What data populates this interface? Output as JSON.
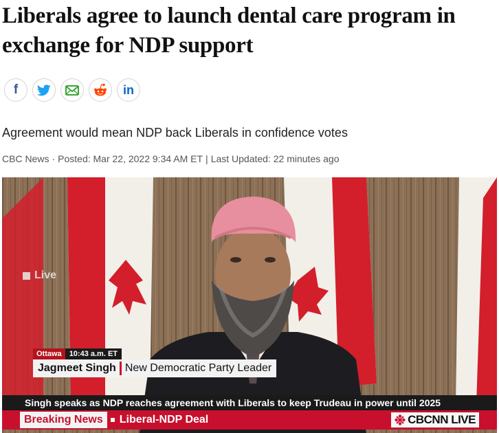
{
  "article": {
    "headline": "Liberals agree to launch dental care program in exchange for NDP support",
    "subtitle": "Agreement would mean NDP back Liberals in confidence votes",
    "byline": {
      "source": "CBC News",
      "posted": "Posted: Mar 22, 2022 9:34 AM ET",
      "updated": "Last Updated: 22 minutes ago"
    }
  },
  "share": [
    {
      "name": "facebook",
      "icon": "facebook-icon",
      "glyph": "f"
    },
    {
      "name": "twitter",
      "icon": "twitter-icon"
    },
    {
      "name": "email",
      "icon": "email-icon"
    },
    {
      "name": "reddit",
      "icon": "reddit-icon"
    },
    {
      "name": "linkedin",
      "icon": "linkedin-icon",
      "glyph": "in"
    }
  ],
  "video": {
    "live_label": "Live",
    "location": "Ottawa",
    "time": "10:43 a.m. ET",
    "speaker_name": "Jagmeet Singh",
    "speaker_title": "New Democratic Party Leader",
    "ticker": "Singh speaks as NDP reaches agreement with Liberals to keep Trudeau in power until 2025",
    "breaking_label": "Breaking News",
    "breaking_topic": "Liberal-NDP Deal",
    "brand": "CBCNN LIVE"
  },
  "colors": {
    "facebook": "#3b5998",
    "twitter": "#1da1f2",
    "email": "#3aa536",
    "reddit": "#ff4500",
    "linkedin": "#0a66c2",
    "cbc_red": "#c8102e"
  }
}
